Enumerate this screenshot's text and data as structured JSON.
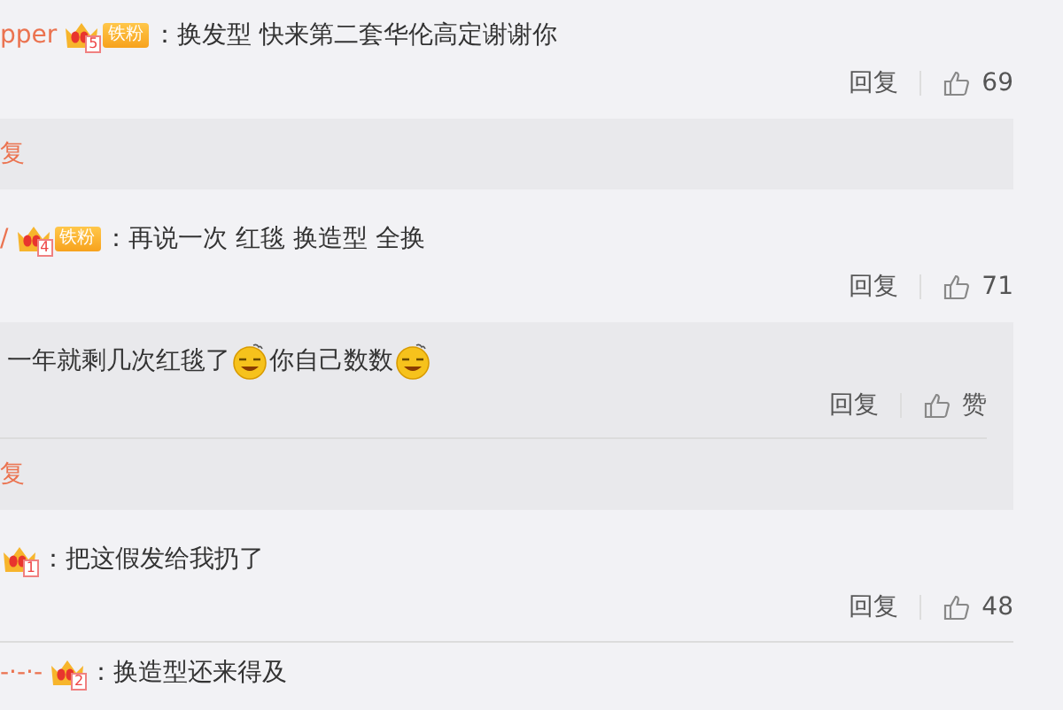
{
  "comments": [
    {
      "user": "pper",
      "rank": "5",
      "badge": "铁粉",
      "text": "：换发型 快来第二套华伦高定谢谢你",
      "reply": "回复",
      "likes": "69",
      "thread": {
        "more": "复"
      }
    },
    {
      "user": "/",
      "rank": "4",
      "badge": "铁粉",
      "text": "：再说一次 红毯 换造型 全换",
      "reply": "回复",
      "likes": "71",
      "thread": {
        "replies": [
          {
            "segments": [
              {
                "kind": "text",
                "text": "一年就剩几次红毯了"
              },
              {
                "kind": "emoji"
              },
              {
                "kind": "text",
                "text": "你自己数数"
              },
              {
                "kind": "emoji"
              }
            ],
            "reply": "回复",
            "likes": "赞"
          }
        ],
        "more": "复"
      }
    },
    {
      "rank": "1",
      "text": "：把这假发给我扔了",
      "reply": "回复",
      "likes": "48"
    },
    {
      "user": "-·-·-",
      "rank": "2",
      "text": "：换造型还来得及"
    }
  ]
}
